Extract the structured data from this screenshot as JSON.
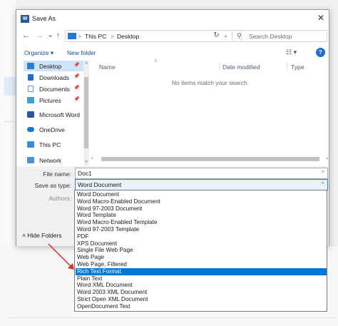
{
  "window": {
    "title": "Save As",
    "app_icon": "W",
    "close_glyph": "✕"
  },
  "nav": {
    "back": "←",
    "forward": "→",
    "history": "⌄",
    "up": "↑",
    "breadcrumb": [
      "This PC",
      "Desktop"
    ],
    "separator": ">",
    "refresh": "↻",
    "search_placeholder": "Search Desktop",
    "search_icon": "⚲"
  },
  "toolbar": {
    "organize": "Organize ▾",
    "new_folder": "New folder",
    "view_icon": "☷ ▾",
    "help": "?"
  },
  "sidebar": {
    "items": [
      {
        "label": "Desktop",
        "icon": "desktop-icon",
        "color": "#2c7dd6",
        "pinned": true,
        "selected": true
      },
      {
        "label": "Downloads",
        "icon": "download-icon",
        "color": "#1f6fd1",
        "pinned": true,
        "selected": false
      },
      {
        "label": "Documents",
        "icon": "documents-icon",
        "color": "#6c8db8",
        "pinned": true,
        "selected": false
      },
      {
        "label": "Pictures",
        "icon": "pictures-icon",
        "color": "#3aa0d8",
        "pinned": true,
        "selected": false
      },
      {
        "label": "Microsoft Word",
        "icon": "word-icon",
        "color": "#2b579a",
        "pinned": false,
        "selected": false
      },
      {
        "label": "OneDrive",
        "icon": "onedrive-icon",
        "color": "#1b76d2",
        "pinned": false,
        "selected": false
      },
      {
        "label": "This PC",
        "icon": "computer-icon",
        "color": "#3c8ad8",
        "pinned": false,
        "selected": false
      },
      {
        "label": "Network",
        "icon": "network-icon",
        "color": "#4a90d9",
        "pinned": false,
        "selected": false
      }
    ],
    "pin_glyph": "📌"
  },
  "file_list": {
    "columns": [
      "Name",
      "Date modified",
      "Type"
    ],
    "empty_message": "No items match your search."
  },
  "form": {
    "file_name_label": "File name:",
    "file_name_value": "Doc1",
    "save_as_type_label": "Save as type:",
    "save_as_type_value": "Word Document",
    "authors_label": "Authors:",
    "hide_folders": "Hide Folders"
  },
  "save_type_options": [
    "Word Document",
    "Word Macro-Enabled Document",
    "Word 97-2003 Document",
    "Word Template",
    "Word Macro-Enabled Template",
    "Word 97-2003 Template",
    "PDF",
    "XPS Document",
    "Single File Web Page",
    "Web Page",
    "Web Page, Filtered",
    "Rich Text Format",
    "Plain Text",
    "Word XML Document",
    "Word 2003 XML Document",
    "Strict Open XML Document",
    "OpenDocument Text"
  ],
  "selected_option": "Rich Text Format",
  "colors": {
    "accent": "#0078d7",
    "annotation_arrow": "#d32f2f",
    "selection_bg": "#cde4f7"
  }
}
